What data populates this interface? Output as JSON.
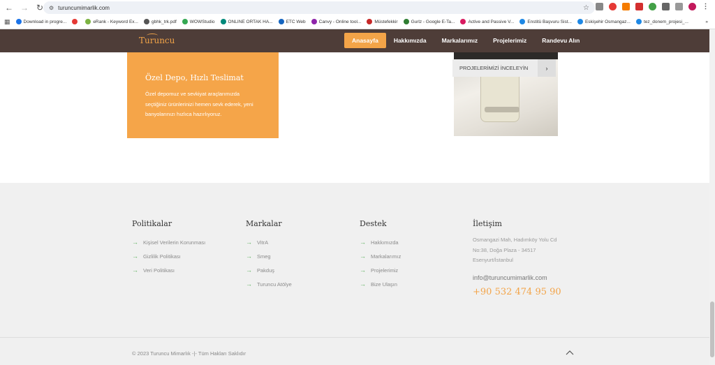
{
  "browser": {
    "url": "turuncumimarlik.com",
    "bookmarks": [
      {
        "label": "Download in progre...",
        "color": "#1a73e8"
      },
      {
        "label": "",
        "color": "#e53935"
      },
      {
        "label": "eRank - Keyword Ex...",
        "color": "#7cb342"
      },
      {
        "label": "gbhk_trk.pdf",
        "color": "#555555"
      },
      {
        "label": "WOWStudio",
        "color": "#34a853"
      },
      {
        "label": "ONLINE ORTAK HA...",
        "color": "#00897b"
      },
      {
        "label": "ETC Web",
        "color": "#1565c0"
      },
      {
        "label": "Canvy - Online tool...",
        "color": "#8e24aa"
      },
      {
        "label": "Müstefekkir",
        "color": "#c62828"
      },
      {
        "label": "Gurlz - Google E-Ta...",
        "color": "#2e7d32"
      },
      {
        "label": "Active and Passive V...",
        "color": "#d81b60"
      },
      {
        "label": "Enstitü Başvuru Sist...",
        "color": "#1e88e5"
      },
      {
        "label": "Eskişehir Osmangaz...",
        "color": "#1e88e5"
      },
      {
        "label": "tez_donem_projesi_...",
        "color": "#1e88e5"
      }
    ],
    "bookmarks_more": "»"
  },
  "site": {
    "logo": "Turuncu",
    "menu": [
      {
        "label": "Anasayfa",
        "active": true
      },
      {
        "label": "Hakkımızda",
        "active": false
      },
      {
        "label": "Markalarımız",
        "active": false
      },
      {
        "label": "Projelerimiz",
        "active": false
      },
      {
        "label": "Randevu Alın",
        "active": false
      }
    ],
    "accent": "#f3a448",
    "nav_color": "#4e3d38"
  },
  "card": {
    "title": "Özel Depo, Hızlı Teslimat",
    "text": "Özel depomuz ve sevkiyat araçlarımızda seçtiğiniz ürünlerinizi hemen sevk ederek, yeni banyolarınızı hızlıca hazırlıyoruz."
  },
  "projects_button": {
    "label": "PROJELERİMİZİ İNCELEYİN",
    "arrow": "›"
  },
  "footer": {
    "columns": [
      {
        "title": "Politikalar",
        "links": [
          "Kişisel Verilerin Korunması",
          "Gizlilik Politikası",
          "Veri Politikası"
        ]
      },
      {
        "title": "Markalar",
        "links": [
          "VitrA",
          "Smeg",
          "Pakduş",
          "Turuncu Atölye"
        ]
      },
      {
        "title": "Destek",
        "links": [
          "Hakkımızda",
          "Markalarımız",
          "Projelerimiz",
          "Bize Ulaşın"
        ]
      }
    ],
    "contact": {
      "title": "İletişim",
      "address_lines": [
        "Osmangazi Mah, Hadımköy Yolu Cd",
        "No:38, Doğa Plaza - 34517",
        "Esenyurt/İstanbul"
      ],
      "email": "info@turuncumimarlik.com",
      "phone": "+90 532 474 95 90"
    },
    "copyright": "© 2023 Turuncu Mimarlık -|- Tüm Hakları Saklıdır",
    "link_arrow": "→"
  }
}
